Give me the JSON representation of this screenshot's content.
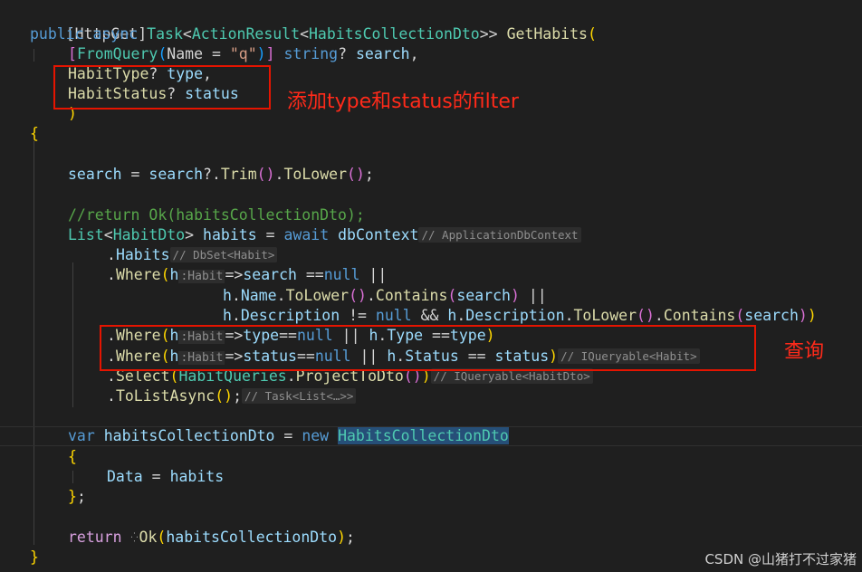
{
  "annotations": {
    "filter_note": "添加type和status的filter",
    "query_note": "查询"
  },
  "watermark": "CSDN @山猪打不过家猪",
  "code": {
    "http_get": "[HttpGet]",
    "sig_public": "public",
    "sig_async": "async",
    "sig_task": "Task",
    "sig_action_result": "ActionResult",
    "sig_dto": "HabitsCollectionDto",
    "sig_method": "GetHabits",
    "from_query": "FromQuery",
    "name_arg": "Name",
    "name_value": "\"q\"",
    "string_kw": "string",
    "search_param": "search",
    "habit_type": "HabitType",
    "type_param": "type",
    "habit_status": "HabitStatus",
    "status_param": "status",
    "search_var": "search",
    "trim": "Trim",
    "to_lower": "ToLower",
    "comment_return": "//return Ok(habitsCollectionDto);",
    "list_type": "List",
    "habit_dto": "HabitDto",
    "habits_var": "habits",
    "await_kw": "await",
    "db_context": "dbContext",
    "hint_app_db": "// ApplicationDbContext",
    "habits_prop": "Habits",
    "hint_dbset": "// DbSet<Habit>",
    "where": "Where",
    "h": "h",
    "hint_habit": ":Habit",
    "null_kw": "null",
    "name_prop": "Name",
    "contains": "Contains",
    "description_prop": "Description",
    "type_prop": "Type",
    "status_prop": "Status",
    "hint_iqueryable_habit": "// IQueryable<Habit>",
    "select": "Select",
    "habit_queries": "HabitQueries",
    "project_to_dto": "ProjectToDto",
    "hint_iqueryable_dto": "// IQueryable<HabitDto>",
    "to_list_async": "ToListAsync",
    "hint_task_list": "// Task<List<…>>",
    "var_kw": "var",
    "collection_var": "habitsCollectionDto",
    "new_kw": "new",
    "collection_type": "HabitsCollectionDto",
    "data_prop": "Data",
    "return_kw": "return",
    "ok_fn": "Ok"
  }
}
